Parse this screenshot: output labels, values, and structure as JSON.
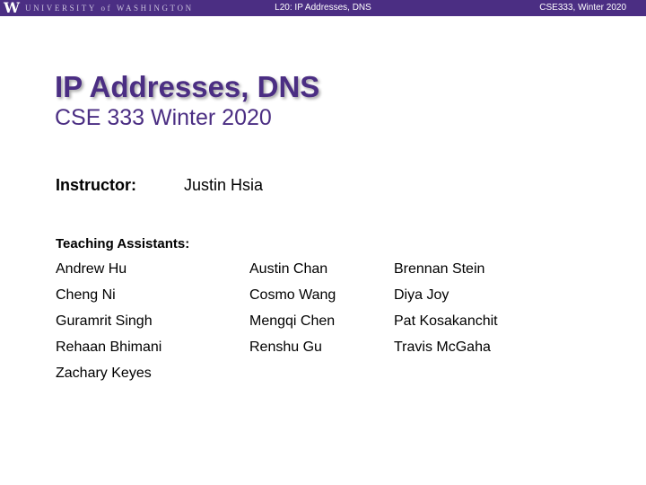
{
  "header": {
    "logo_letter": "W",
    "logo_text": "UNIVERSITY of WASHINGTON",
    "lecture": "L20: IP Addresses, DNS",
    "course_term": "CSE333, Winter 2020",
    "bar_color": "#4b2e83"
  },
  "title": "IP Addresses, DNS",
  "subtitle": "CSE 333 Winter 2020",
  "instructor": {
    "label": "Instructor:",
    "name": "Justin Hsia"
  },
  "tas": {
    "label": "Teaching Assistants:",
    "columns": [
      [
        "Andrew Hu",
        "Cheng Ni",
        "Guramrit Singh",
        "Rehaan Bhimani",
        "Zachary Keyes"
      ],
      [
        "Austin Chan",
        "Cosmo Wang",
        "Mengqi Chen",
        "Renshu Gu"
      ],
      [
        "Brennan Stein",
        "Diya Joy",
        "Pat Kosakanchit",
        "Travis McGaha"
      ]
    ]
  }
}
